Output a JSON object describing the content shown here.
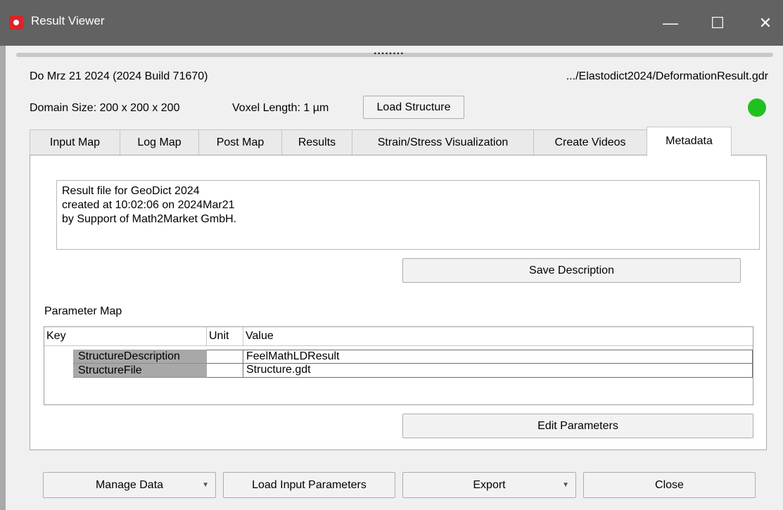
{
  "window": {
    "title": "Result Viewer",
    "controls": {
      "minimize": "—",
      "maximize": "☐",
      "close": "✕"
    }
  },
  "splitter_handle": "........",
  "info": {
    "date_build": "Do Mrz 21 2024 (2024 Build 71670)",
    "file_path": ".../Elastodict2024/DeformationResult.gdr",
    "domain_size": "Domain Size: 200 x 200 x 200",
    "voxel_length": "Voxel Length: 1 µm",
    "load_structure_label": "Load Structure",
    "status_color": "#1fc11f"
  },
  "tabs": [
    {
      "label": "Input Map",
      "active": false
    },
    {
      "label": "Log Map",
      "active": false
    },
    {
      "label": "Post Map",
      "active": false
    },
    {
      "label": "Results",
      "active": false
    },
    {
      "label": "Strain/Stress Visualization",
      "active": false
    },
    {
      "label": "Create Videos",
      "active": false
    },
    {
      "label": "Metadata",
      "active": true
    }
  ],
  "metadata": {
    "description_lines": [
      "Result file for GeoDict 2024",
      "created at 10:02:06 on 2024Mar21",
      "by Support of Math2Market GmbH."
    ],
    "save_description_label": "Save Description",
    "parameter_map_label": "Parameter Map",
    "table": {
      "headers": {
        "key": "Key",
        "unit": "Unit",
        "value": "Value"
      },
      "rows": [
        {
          "key": "StructureDescription",
          "unit": "",
          "value": "FeelMathLDResult"
        },
        {
          "key": "StructureFile",
          "unit": "",
          "value": "Structure.gdt"
        }
      ]
    },
    "edit_parameters_label": "Edit Parameters"
  },
  "bottom_buttons": {
    "manage_data": "Manage Data",
    "load_input_parameters": "Load Input Parameters",
    "export": "Export",
    "close": "Close",
    "dropdown_glyph": "▼"
  }
}
